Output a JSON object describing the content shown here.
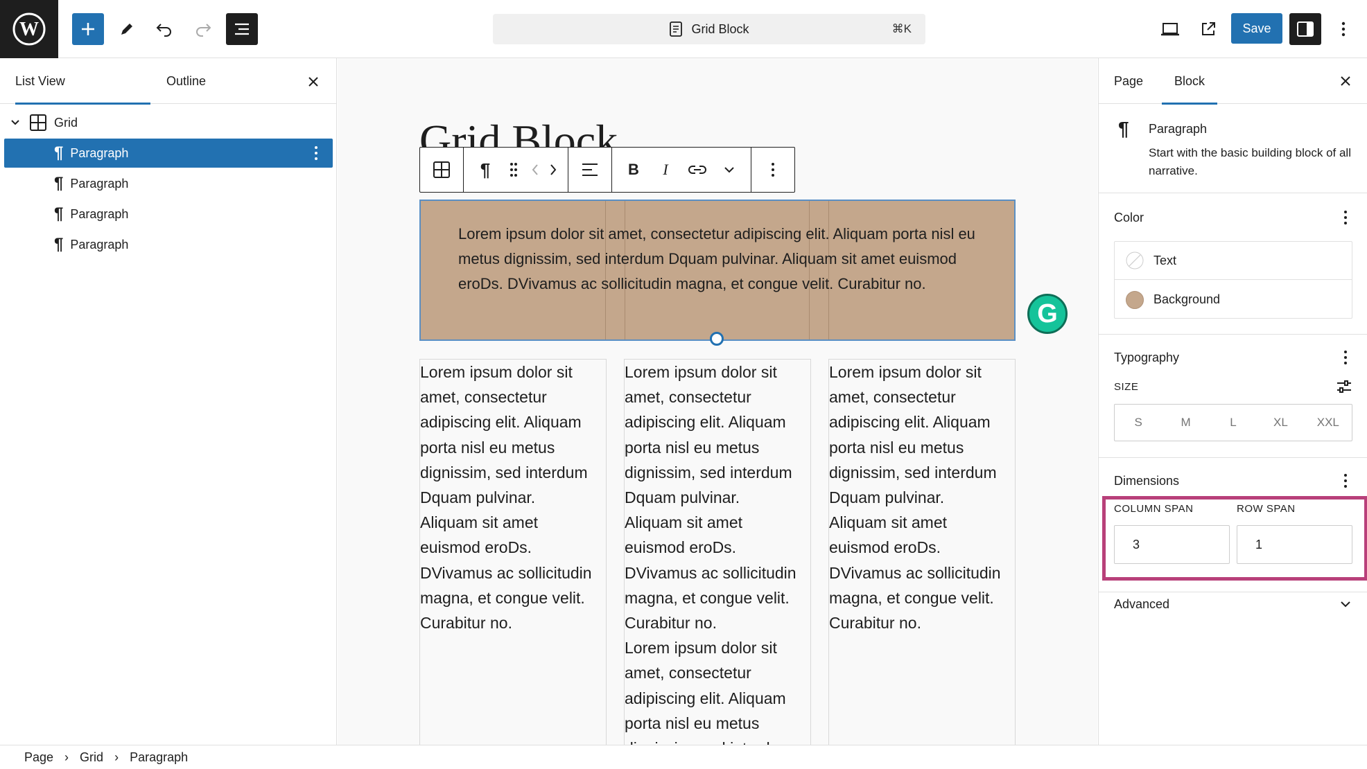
{
  "topbar": {
    "document_title": "Grid Block",
    "shortcut": "⌘K",
    "save_label": "Save"
  },
  "list_view": {
    "tabs": [
      "List View",
      "Outline"
    ],
    "tree": [
      {
        "label": "Grid",
        "icon": "grid-icon",
        "selected": false
      },
      {
        "label": "Paragraph",
        "icon": "paragraph-icon",
        "selected": true
      },
      {
        "label": "Paragraph",
        "icon": "paragraph-icon",
        "selected": false
      },
      {
        "label": "Paragraph",
        "icon": "paragraph-icon",
        "selected": false
      },
      {
        "label": "Paragraph",
        "icon": "paragraph-icon",
        "selected": false
      }
    ]
  },
  "canvas": {
    "page_title": "Grid Block",
    "hero_text": "Lorem ipsum dolor sit amet, consectetur adipiscing elit. Aliquam porta nisl eu metus dignissim, sed interdum Dquam pulvinar. Aliquam sit amet euismod eroDs. DVivamus ac sollicitudin magna, et congue velit. Curabitur no.",
    "hero_background": "#c4a78c",
    "columns": [
      "Lorem ipsum dolor sit\namet, consectetur\nadipiscing elit. Aliquam\nporta nisl eu metus\ndignissim, sed interdum\nDquam pulvinar.\nAliquam sit amet\neuismod eroDs.\nDVivamus ac sollicitudin\nmagna, et congue velit.\nCurabitur no.",
      "Lorem ipsum dolor sit\namet, consectetur\nadipiscing elit. Aliquam\nporta nisl eu metus\ndignissim, sed interdum\nDquam pulvinar.\nAliquam sit amet\neuismod eroDs.\nDVivamus ac sollicitudin\nmagna, et congue velit.\nCurabitur no.\nLorem ipsum dolor sit\namet, consectetur\nadipiscing elit. Aliquam\nporta nisl eu metus\ndignissim, sed interdum",
      "Lorem ipsum dolor sit\namet, consectetur\nadipiscing elit. Aliquam\nporta nisl eu metus\ndignissim, sed interdum\nDquam pulvinar.\nAliquam sit amet\neuismod eroDs.\nDVivamus ac sollicitudin\nmagna, et congue velit.\nCurabitur no."
    ]
  },
  "inspector": {
    "tabs": [
      "Page",
      "Block"
    ],
    "active_tab": "Block",
    "block_card": {
      "title": "Paragraph",
      "description": "Start with the basic building block of all narrative."
    },
    "color": {
      "heading": "Color",
      "text_label": "Text",
      "background_label": "Background",
      "background_swatch": "#c4a78c"
    },
    "typography": {
      "heading": "Typography",
      "size_label": "SIZE",
      "sizes": [
        "S",
        "M",
        "L",
        "XL",
        "XXL"
      ]
    },
    "dimensions": {
      "heading": "Dimensions",
      "column_span_label": "COLUMN SPAN",
      "column_span_value": "3",
      "row_span_label": "ROW SPAN",
      "row_span_value": "1",
      "highlight_color": "#b8407a"
    },
    "advanced": {
      "heading": "Advanced"
    }
  },
  "breadcrumb": [
    "Page",
    "Grid",
    "Paragraph"
  ],
  "colors": {
    "accent": "#2271b1"
  }
}
